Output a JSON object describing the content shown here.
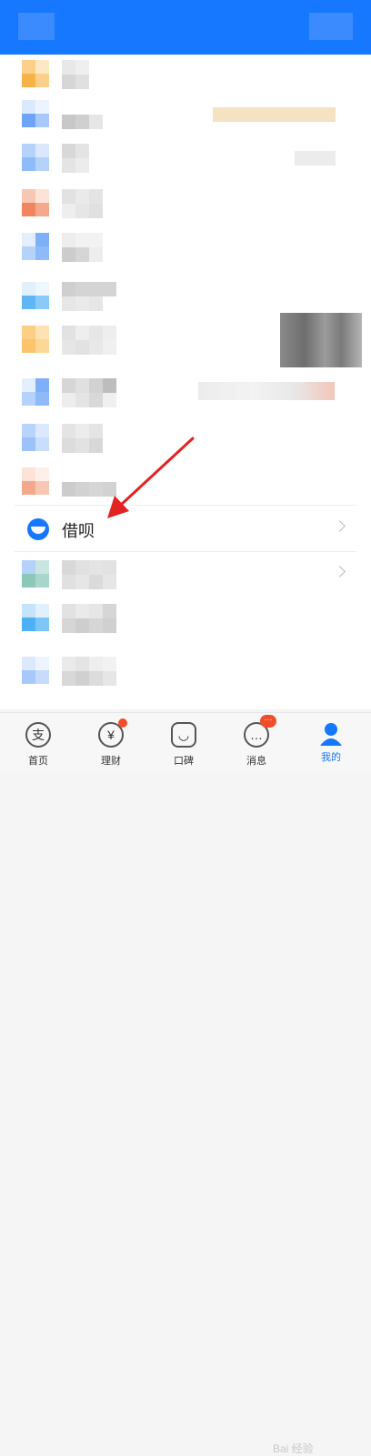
{
  "menu": {
    "highlighted_item": {
      "label": "借呗",
      "icon": "jiebei-icon"
    }
  },
  "tabbar": {
    "items": [
      {
        "label": "首页",
        "icon": "支"
      },
      {
        "label": "理财",
        "icon": "¥"
      },
      {
        "label": "口碑",
        "icon": "◡"
      },
      {
        "label": "消息",
        "icon": "…"
      },
      {
        "label": "我的",
        "icon": "person-icon",
        "active": true
      }
    ]
  },
  "watermark": "Bai 经验"
}
